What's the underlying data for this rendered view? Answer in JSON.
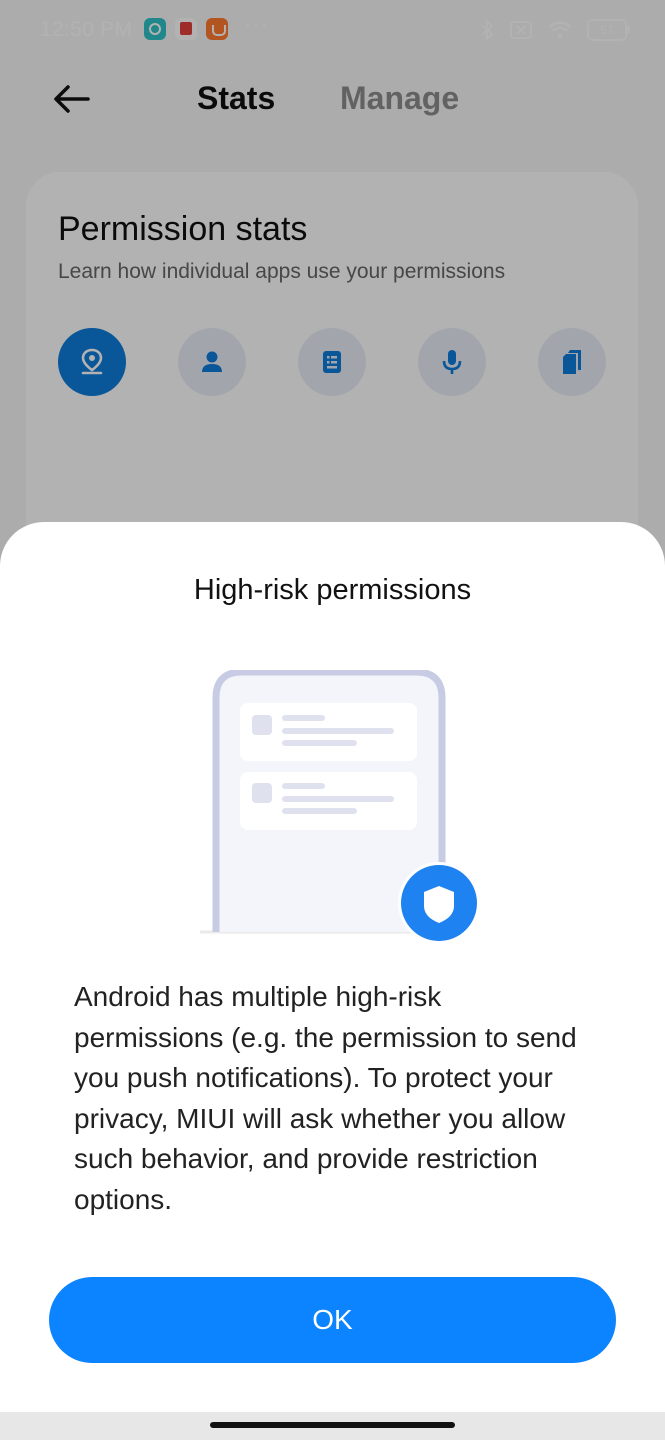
{
  "status_bar": {
    "time": "12:50 PM",
    "apps": [
      "circle-app-icon",
      "red-app-icon",
      "orange-bag-app-icon"
    ],
    "more": "···",
    "battery": "57"
  },
  "header": {
    "tabs": [
      {
        "label": "Stats",
        "active": true
      },
      {
        "label": "Manage",
        "active": false
      }
    ]
  },
  "card": {
    "title": "Permission stats",
    "subtitle": "Learn how individual apps use your permissions",
    "permissions": [
      {
        "icon": "location-icon",
        "active": true
      },
      {
        "icon": "contacts-icon",
        "active": false
      },
      {
        "icon": "sms-icon",
        "active": false
      },
      {
        "icon": "microphone-icon",
        "active": false
      },
      {
        "icon": "storage-icon",
        "active": false
      }
    ]
  },
  "dialog": {
    "title": "High-risk permissions",
    "body": "Android has multiple high-risk permissions (e.g. the permission to send you push notifications). To protect your privacy, MIUI will ask whether you allow such behavior, and provide restriction options.",
    "ok_label": "OK"
  },
  "colors": {
    "accent": "#0d84ff",
    "active_icon_bg": "#0d7cdc",
    "inactive_icon_bg": "#e9eef6"
  }
}
